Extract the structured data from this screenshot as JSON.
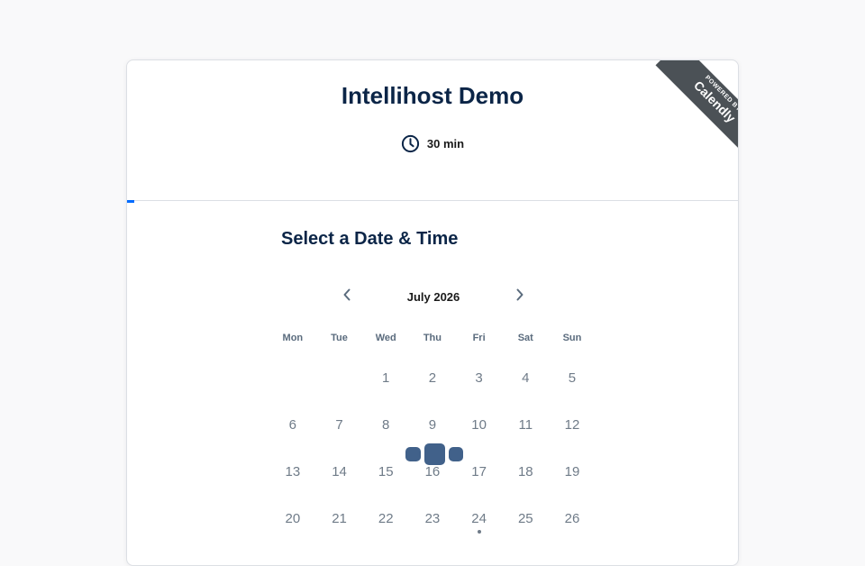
{
  "event": {
    "title": "Intellihost Demo",
    "duration": "30 min",
    "duration_icon": "clock-icon"
  },
  "badge": {
    "small_text": "POWERED BY",
    "brand": "Calendly"
  },
  "scheduler": {
    "title": "Select a Date & Time",
    "month": "July 2026",
    "prev_icon": "chevron-left-icon",
    "next_icon": "chevron-right-icon",
    "weekdays": [
      "Mon",
      "Tue",
      "Wed",
      "Thu",
      "Fri",
      "Sat",
      "Sun"
    ],
    "days": [
      "1",
      "2",
      "3",
      "4",
      "5",
      "6",
      "7",
      "8",
      "9",
      "10",
      "11",
      "12",
      "13",
      "14",
      "15",
      "16",
      "17",
      "18",
      "19",
      "20",
      "21",
      "22",
      "23",
      "24",
      "25",
      "26"
    ],
    "today": "24"
  },
  "colors": {
    "accent": "#006bff",
    "title": "#0b2547",
    "ribbon": "#4b5156",
    "day_text": "#6f7b88",
    "loader": "#41618a"
  }
}
